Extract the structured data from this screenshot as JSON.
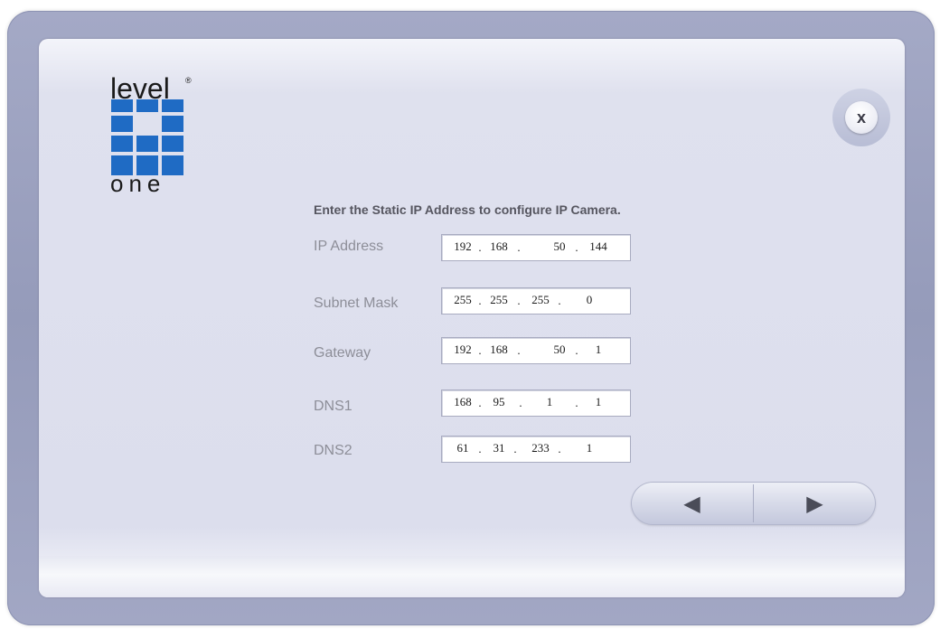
{
  "logo": {
    "top_text": "level",
    "registered_mark": "®",
    "bottom_text": "one",
    "color": "#1f6bc4"
  },
  "close_button": {
    "label": "x",
    "icon": "close-icon"
  },
  "form": {
    "instruction": "Enter the Static IP Address to configure IP Camera.",
    "fields": [
      {
        "label": "IP Address",
        "octets": [
          "192",
          "168",
          "50",
          "144"
        ]
      },
      {
        "label": "Subnet Mask",
        "octets": [
          "255",
          "255",
          "255",
          "0"
        ]
      },
      {
        "label": "Gateway",
        "octets": [
          "192",
          "168",
          "50",
          "1"
        ]
      },
      {
        "label": "DNS1",
        "octets": [
          "168",
          "95",
          "1",
          "1"
        ]
      },
      {
        "label": "DNS2",
        "octets": [
          "61",
          "31",
          "233",
          "1"
        ]
      }
    ],
    "separator": "."
  },
  "navigation": {
    "back_icon": "left-arrow-icon",
    "next_icon": "right-arrow-icon",
    "back_glyph": "◀",
    "next_glyph": "▶"
  },
  "colors": {
    "frame": "#9ba0bf",
    "panel": "#dfe1ee",
    "label_text": "#8d8e98",
    "instruction_text": "#565660"
  }
}
